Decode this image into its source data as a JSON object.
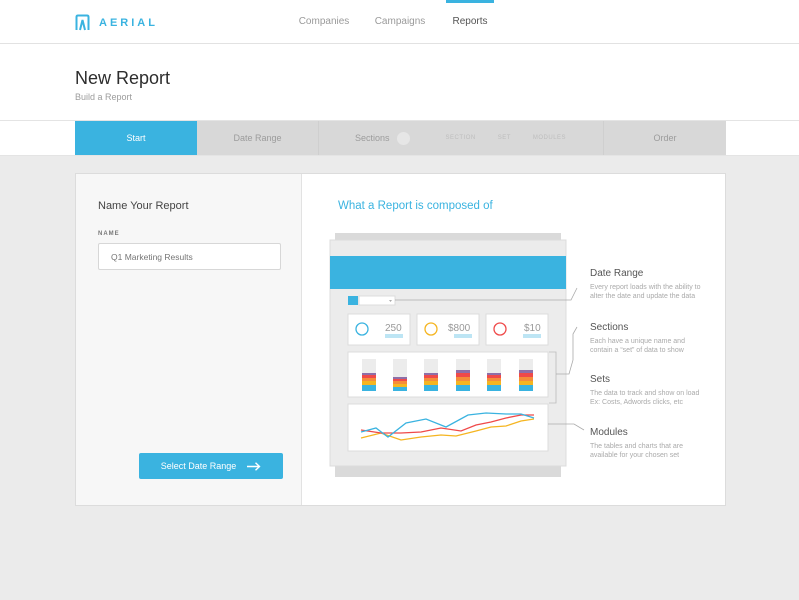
{
  "brand": {
    "name": "AERIAL"
  },
  "nav": {
    "items": [
      "Companies",
      "Campaigns",
      "Reports"
    ],
    "active": "Reports"
  },
  "header": {
    "title": "New Report",
    "subtitle": "Build a Report"
  },
  "stepper": {
    "steps": [
      "Start",
      "Date Range",
      "Sections",
      "Order"
    ],
    "active": "Start",
    "substeps": [
      "SECTION",
      "SET",
      "MODULES"
    ]
  },
  "form": {
    "heading": "Name Your Report",
    "name_label": "NAME",
    "name_placeholder": "Q1 Marketing Results",
    "button_label": "Select Date Range"
  },
  "diagram": {
    "title": "What a Report is composed of",
    "stats": [
      {
        "value": "250",
        "color": "#3ab3e0"
      },
      {
        "value": "$800",
        "color": "#f5b521"
      },
      {
        "value": "$10",
        "color": "#ef4a4a"
      }
    ],
    "annotations": [
      {
        "title": "Date Range",
        "line1": "Every report loads with the ability to",
        "line2": "alter the date and update the data"
      },
      {
        "title": "Sections",
        "line1": "Each have a unique name and",
        "line2": "contain a “set” of data to show"
      },
      {
        "title": "Sets",
        "line1": "The data to track and show on load",
        "line2": "Ex: Costs, Adwords clicks, etc"
      },
      {
        "title": "Modules",
        "line1": "The tables and charts that are",
        "line2": "available for your chosen set"
      }
    ]
  },
  "colors": {
    "accent": "#3ab3e0",
    "yellow": "#f5b521",
    "red": "#ef4a4a",
    "purple": "#8e6fa8",
    "orange": "#f58c3a"
  }
}
